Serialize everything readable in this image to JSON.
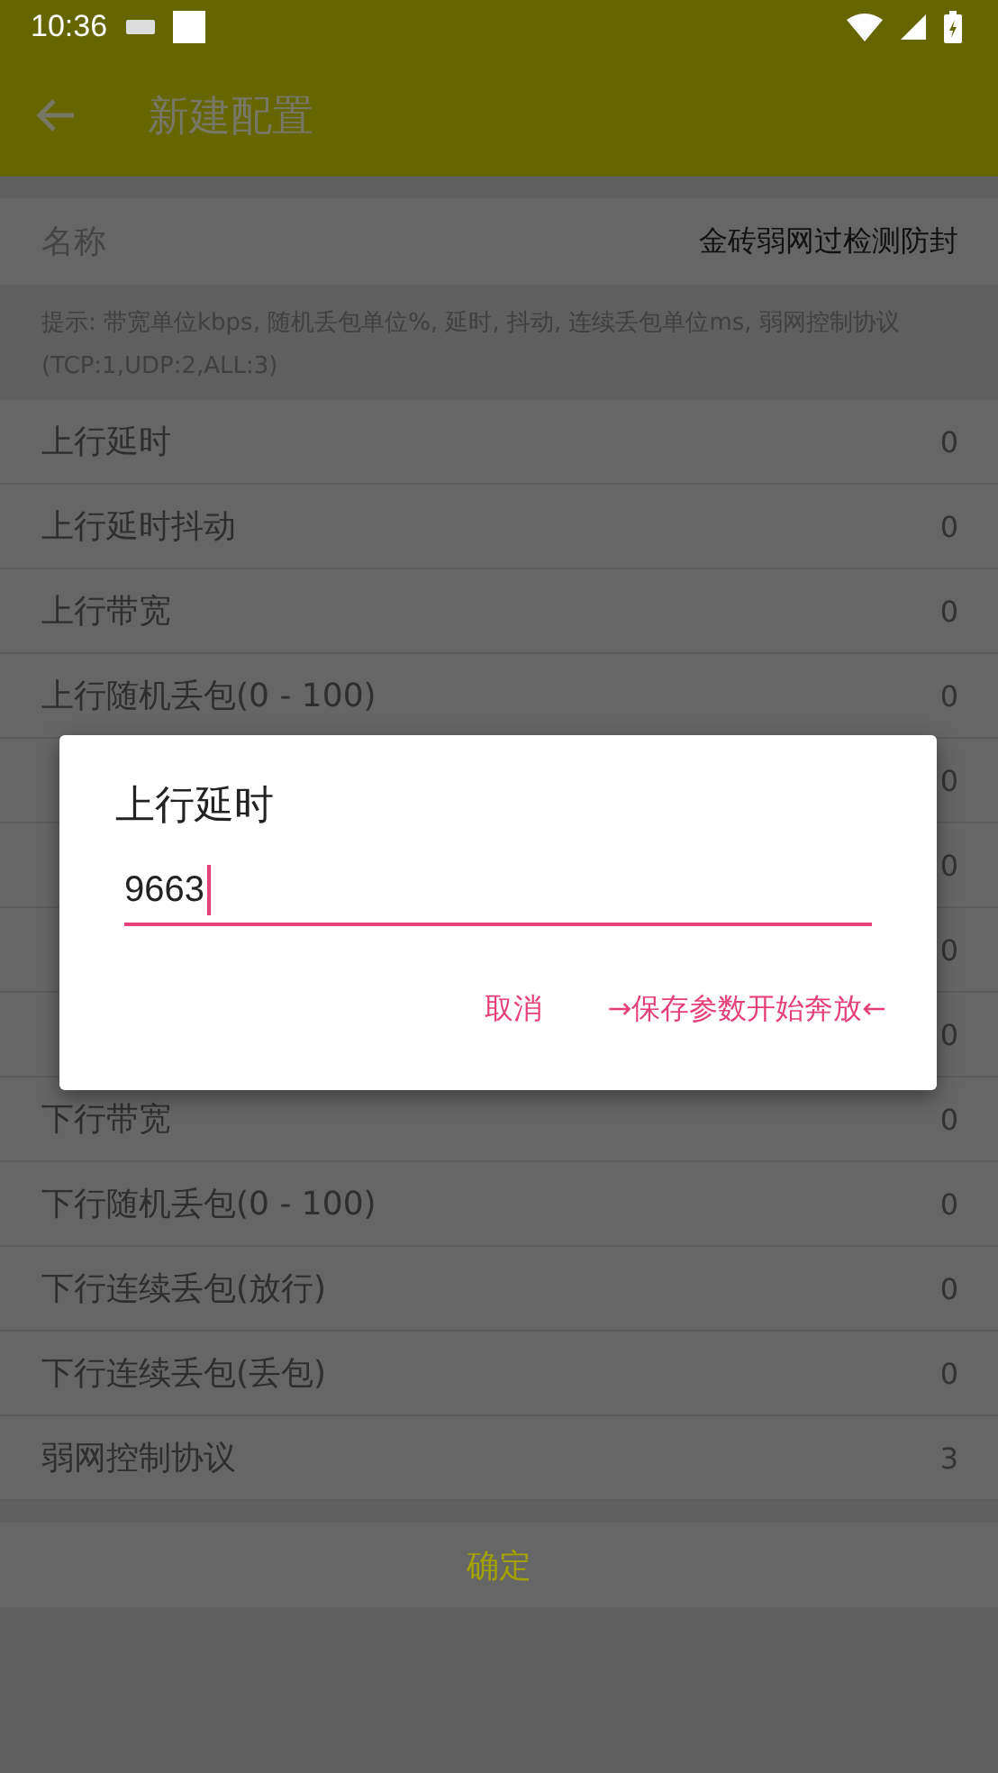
{
  "status_bar": {
    "time": "10:36"
  },
  "app_bar": {
    "title": "新建配置"
  },
  "name_field": {
    "label": "名称",
    "value": "金砖弱网过检测防封"
  },
  "hint": "提示: 带宽单位kbps, 随机丢包单位%, 延时, 抖动, 连续丢包单位ms, 弱网控制协议(TCP:1,UDP:2,ALL:3)",
  "params": [
    {
      "label": "上行延时",
      "value": "0"
    },
    {
      "label": "上行延时抖动",
      "value": "0"
    },
    {
      "label": "上行带宽",
      "value": "0"
    },
    {
      "label": "上行随机丢包(0 - 100)",
      "value": "0"
    },
    {
      "value": "0"
    },
    {
      "value": "0"
    },
    {
      "value": "0"
    },
    {
      "value": "0"
    },
    {
      "label": "下行带宽",
      "value": "0"
    },
    {
      "label": "下行随机丢包(0 - 100)",
      "value": "0"
    },
    {
      "label": "下行连续丢包(放行)",
      "value": "0"
    },
    {
      "label": "下行连续丢包(丢包)",
      "value": "0"
    },
    {
      "label": "弱网控制协议",
      "value": "3"
    }
  ],
  "confirm_button": "确定",
  "dialog": {
    "title": "上行延时",
    "input": {
      "value": "9663"
    },
    "buttons": [
      {
        "label": "取消"
      },
      {
        "label": "→保存参数开始奔放←"
      }
    ]
  }
}
